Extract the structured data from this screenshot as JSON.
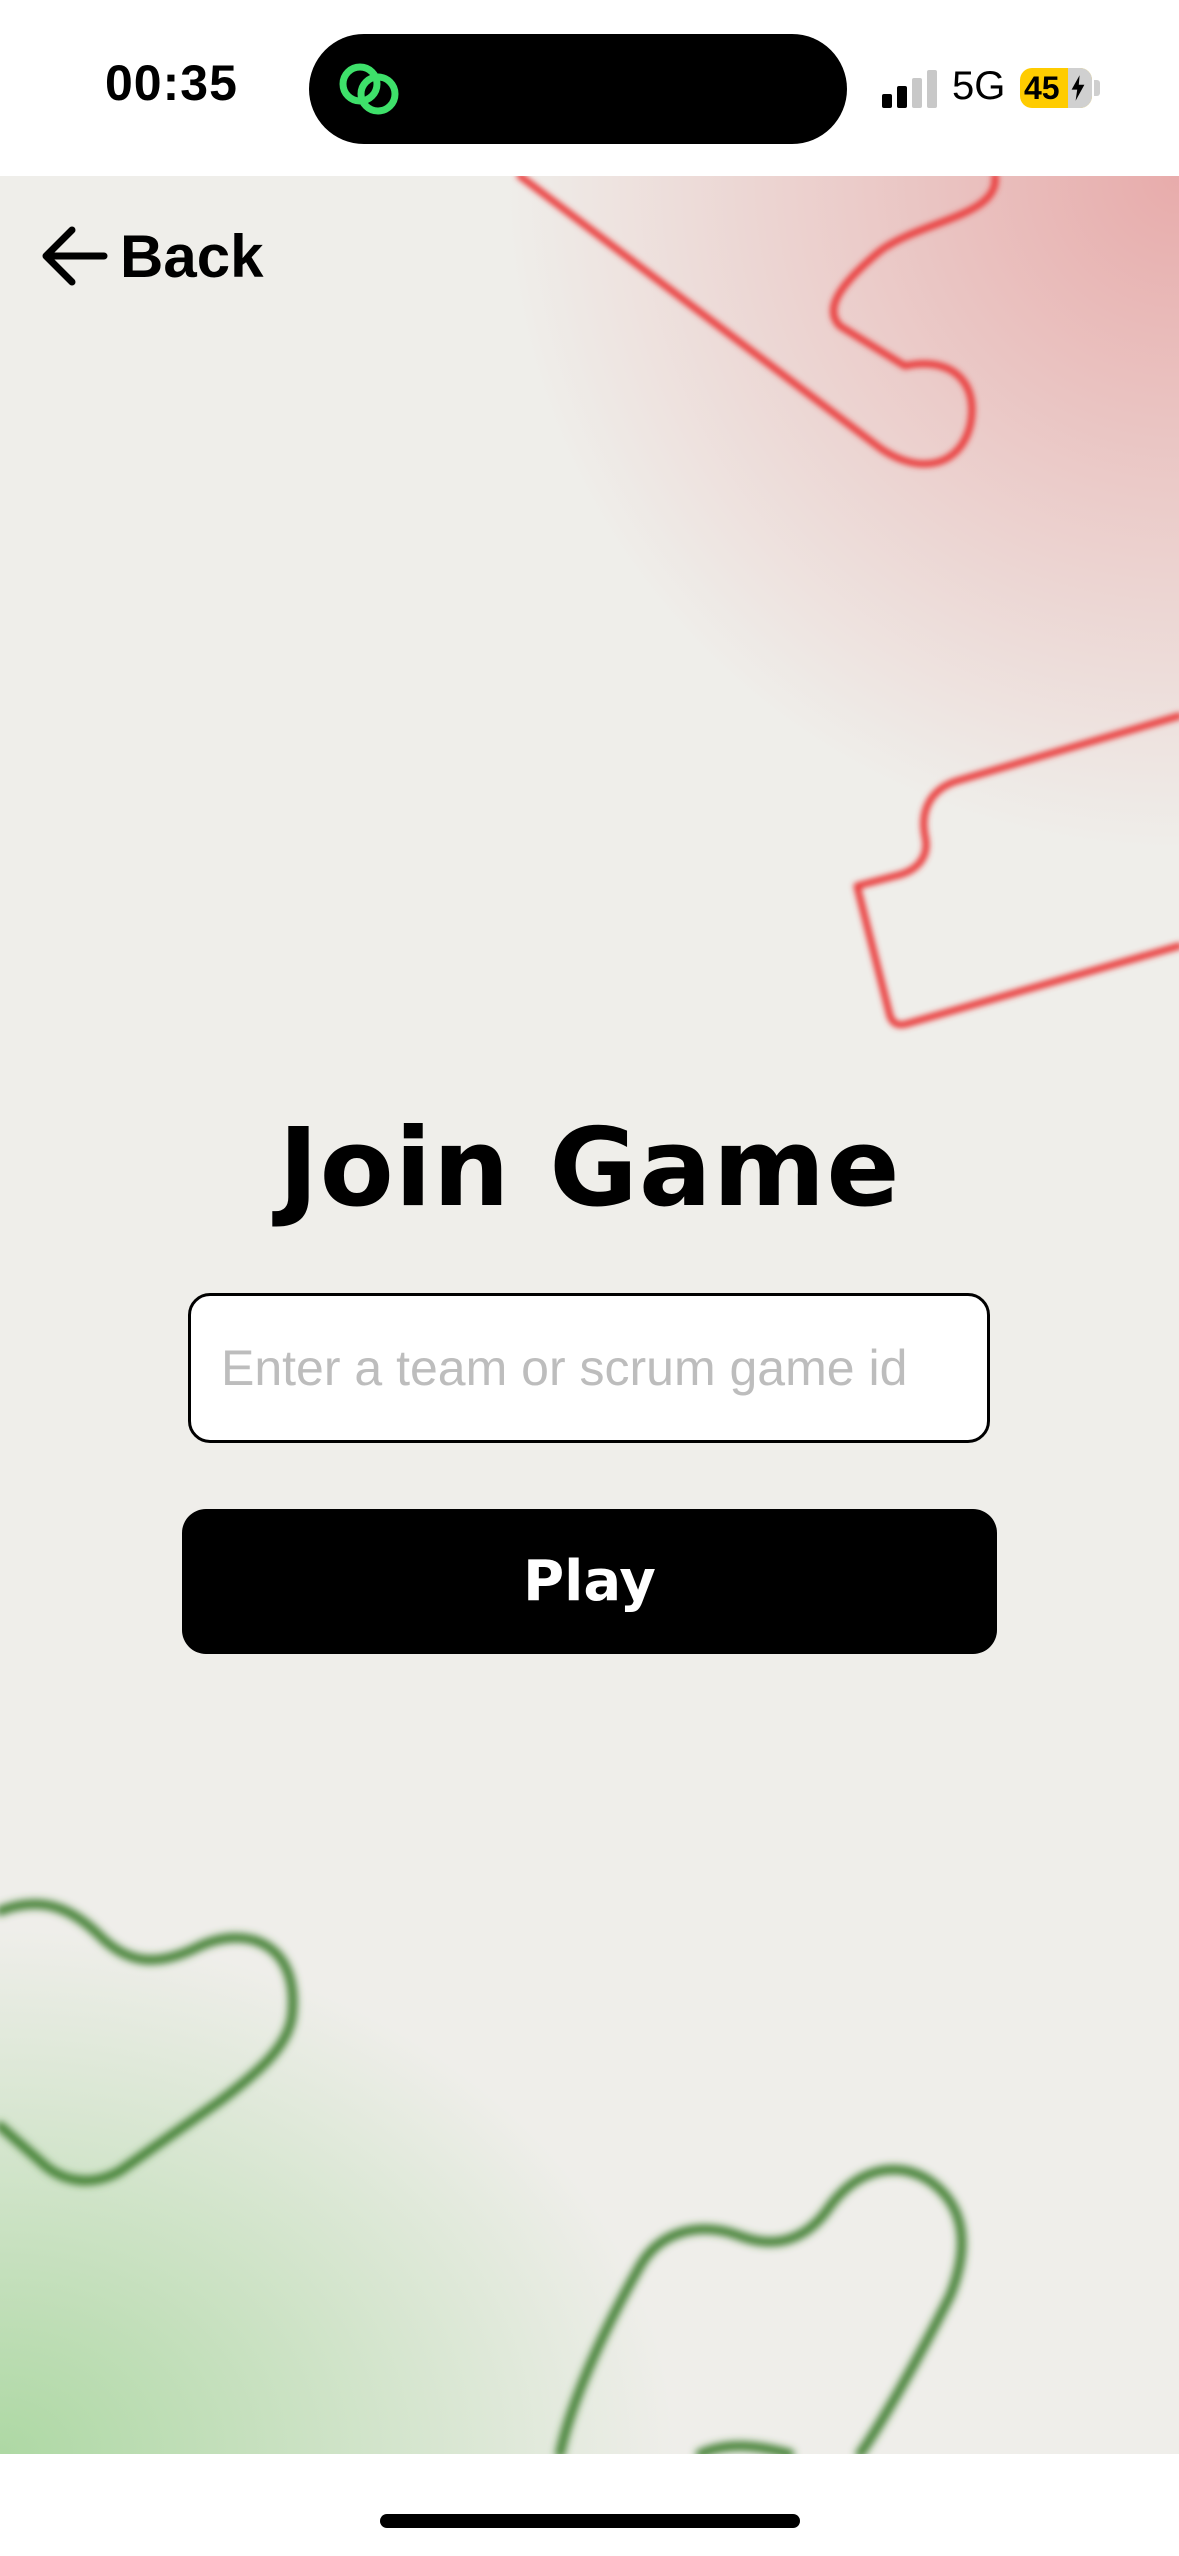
{
  "status_bar": {
    "time": "00:35",
    "network": "5G",
    "battery_level": "45",
    "island_icon": "link-rings-icon",
    "signal_icon": "signal-bars-icon"
  },
  "nav": {
    "back_label": "Back",
    "back_icon": "arrow-left-icon"
  },
  "main": {
    "title": "Join Game",
    "game_id_input": {
      "value": "",
      "placeholder": "Enter a team or scrum game id"
    },
    "play_label": "Play"
  },
  "colors": {
    "accent_red": "#e8403f",
    "accent_green": "#3a7a2a",
    "island_icon_green": "#3ee06a",
    "battery_yellow": "#ffcc00",
    "button_black": "#000000"
  }
}
